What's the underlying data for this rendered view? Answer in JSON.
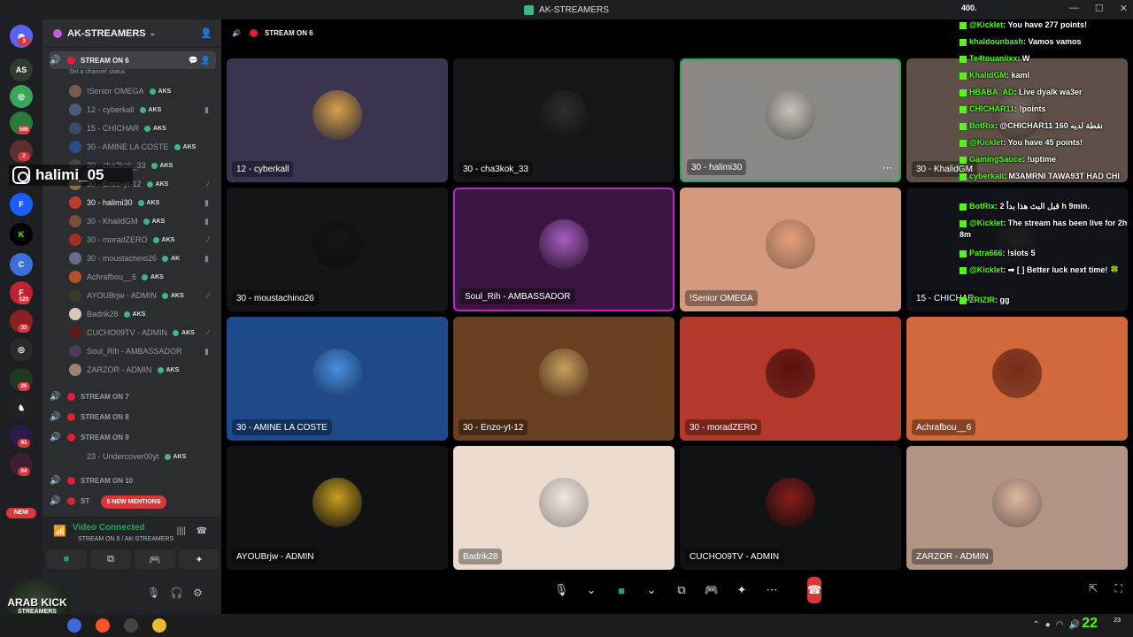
{
  "window": {
    "title": "AK-STREAMERS"
  },
  "rail_badges": [
    "3",
    "566",
    "2",
    "123",
    "33",
    "26",
    "91",
    "64"
  ],
  "rail_new": "NEW",
  "server": {
    "name": "AK-STREAMERS"
  },
  "sidebar": {
    "active_channel": "STREAM ON 6",
    "channel_status": "Set a channel status",
    "members": [
      {
        "name": "!Senior OMEGA",
        "tag": "AKS"
      },
      {
        "name": "12 - cyberkall",
        "tag": "AKS"
      },
      {
        "name": "15 - CHICHAR",
        "tag": "AKS"
      },
      {
        "name": "30 - AMINE LA COSTE",
        "tag": "AKS"
      },
      {
        "name": "30 - cha3kok_33",
        "tag": "AKS"
      },
      {
        "name": "30 - Enzo-yt-12",
        "tag": "AKS"
      },
      {
        "name": "30 - halimi30",
        "tag": "AKS"
      },
      {
        "name": "30 - KhalidGM",
        "tag": "AKS"
      },
      {
        "name": "30 - moradZERO",
        "tag": "AKS"
      },
      {
        "name": "30 - moustachino26",
        "tag": "AK"
      },
      {
        "name": "Achrafbou__6",
        "tag": "AKS"
      },
      {
        "name": "AYOUBrjw - ADMIN",
        "tag": "AKS"
      },
      {
        "name": "Badrik28",
        "tag": "AKS"
      },
      {
        "name": "CUCHO09TV - ADMIN",
        "tag": "AKS"
      },
      {
        "name": "Soul_Rih - AMBASSADOR",
        "tag": ""
      },
      {
        "name": "ZARZOR - ADMIN",
        "tag": "AKS"
      }
    ],
    "other_channels": [
      "STREAM ON 7",
      "STREAM ON 8",
      "STREAM ON 9"
    ],
    "ch9_member": {
      "name": "23 - Undercover00yt",
      "tag": "AKS"
    },
    "ch10": "STREAM ON 10",
    "ch11": "ST",
    "new_mentions": "5 NEW MENTIONS"
  },
  "voice_panel": {
    "status": "Video Connected",
    "location": "STREAM ON 6 / AK-STREAMERS"
  },
  "main": {
    "channel_title": "STREAM ON 6",
    "tiles": [
      {
        "label": "12 - cyberkall",
        "bg": "#3b3450"
      },
      {
        "label": "30 - cha3kok_33",
        "bg": "#15161a"
      },
      {
        "label": "30 - halimi30",
        "bg": "#8a8784"
      },
      {
        "label": "30 - KhalidGM",
        "bg": "#5e5048"
      },
      {
        "label": "30 - moustachino26",
        "bg": "#141518"
      },
      {
        "label": "Soul_Rih - AMBASSADOR",
        "bg": "#3a1640"
      },
      {
        "label": "!Senior OMEGA",
        "bg": "#d49a80"
      },
      {
        "label": "15 - CHICHAR",
        "bg": "#121318"
      },
      {
        "label": "30 - AMINE LA COSTE",
        "bg": "#1e4a8c"
      },
      {
        "label": "30 - Enzo-yt-12",
        "bg": "#6b3f22"
      },
      {
        "label": "30 - moradZERO",
        "bg": "#b5392a"
      },
      {
        "label": "Achrafbou__6",
        "bg": "#d1683c"
      },
      {
        "label": "AYOUBrjw - ADMIN",
        "bg": "#111214"
      },
      {
        "label": "Badrik28",
        "bg": "#ecdcd0"
      },
      {
        "label": "CUCHO09TV - ADMIN",
        "bg": "#111214"
      },
      {
        "label": "ZARZOR - ADMIN",
        "bg": "#b19484"
      }
    ]
  },
  "chat": {
    "viewers": "400.",
    "messages": [
      {
        "user": "@Kicklet",
        "text": ": You have 277 points!"
      },
      {
        "user": "khaldounbash",
        "text": ": Vamos vamos"
      },
      {
        "user": "Te4touaniixx",
        "text": ": W"
      },
      {
        "user": "KhalidGM",
        "text": ": kaml"
      },
      {
        "user": "HBABA_AD",
        "text": ": Live dyalk wa3er"
      },
      {
        "user": "CHICHAR11",
        "text": ": !points"
      },
      {
        "user": "BotRix",
        "text": ": @CHICHAR11 160 نقطة لديه"
      },
      {
        "user": "@Kicklet",
        "text": ": You have 45 points!"
      },
      {
        "user": "GamingSauce",
        "text": ": !uptime"
      },
      {
        "user": "cyberkall",
        "text": ": M3AMRNI TAWA93T HAD CHI"
      },
      {
        "user": "BotRix",
        "text": ": 2 قبل البث هذا بدأ h 9min."
      },
      {
        "user": "@Kicklet",
        "text": ": The stream has been live for 2h 8m"
      },
      {
        "user": "Patra666",
        "text": ": !slots 5"
      },
      {
        "user": "@Kicklet",
        "text": ": ➡ [ ] Better luck next time! 🍀"
      },
      {
        "user": "ZRIZIR",
        "text": ": gg"
      }
    ]
  },
  "overlay": {
    "instagram_handle": "halimi_05",
    "brand_line1": "ARAB KICK",
    "brand_line2": "STREAMERS"
  },
  "taskbar": {
    "big_number": "22",
    "clock": "23"
  }
}
